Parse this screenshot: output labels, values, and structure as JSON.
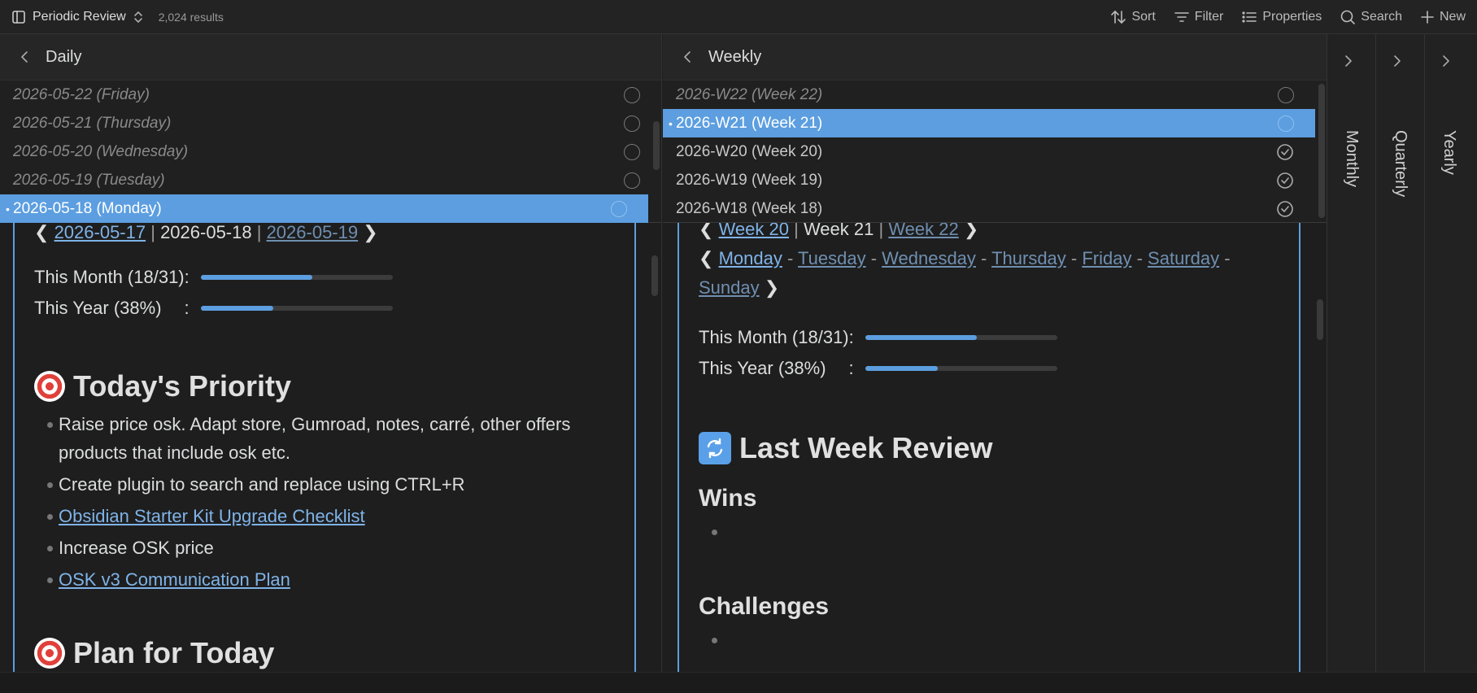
{
  "topbar": {
    "title": "Periodic Review",
    "count": "2,024 results",
    "sort": "Sort",
    "filter": "Filter",
    "properties": "Properties",
    "search": "Search",
    "new": "New"
  },
  "daily": {
    "title": "Daily",
    "rows": [
      {
        "label": "2026-05-22 (Friday)"
      },
      {
        "label": "2026-05-21 (Thursday)"
      },
      {
        "label": "2026-05-20 (Wednesday)"
      },
      {
        "label": "2026-05-19 (Tuesday)"
      },
      {
        "label": "2026-05-18 (Monday)"
      }
    ],
    "note": {
      "prev_arrow": "❮",
      "prev": "2026-05-17",
      "sep1": " | ",
      "current": "2026-05-18",
      "sep2": " | ",
      "next": "2026-05-19",
      "next_arrow": "❯",
      "month_label": "This Month (18/31):",
      "month_progress": 0.58,
      "year_label": "This Year (38%)",
      "year_colon": ":",
      "year_progress": 0.38,
      "priority_title": "Today's Priority",
      "priorities": [
        {
          "text": "Raise price osk. Adapt store, Gumroad, notes, carré, other offers products that include osk etc."
        },
        {
          "text": "Create plugin to search and replace using CTRL+R"
        },
        {
          "text": "Obsidian Starter Kit Upgrade Checklist"
        },
        {
          "text": "Increase OSK price"
        },
        {
          "text": "OSK v3 Communication Plan"
        }
      ],
      "plan_title": "Plan for Today"
    }
  },
  "weekly": {
    "title": "Weekly",
    "rows": [
      {
        "label": "2026-W22 (Week 22)"
      },
      {
        "label": "2026-W21 (Week 21)"
      },
      {
        "label": "2026-W20 (Week 20)"
      },
      {
        "label": "2026-W19 (Week 19)"
      },
      {
        "label": "2026-W18 (Week 18)"
      }
    ],
    "note": {
      "prev_arrow": "❮",
      "prev": "Week 20",
      "sep1": " | ",
      "current": "Week 21",
      "sep2": " | ",
      "next": "Week 22",
      "next_arrow": "❯",
      "days": [
        "Monday",
        "Tuesday",
        "Wednesday",
        "Thursday",
        "Friday",
        "Saturday",
        "Sunday"
      ],
      "dash": " - ",
      "month_label": "This Month (18/31):",
      "month_progress": 0.58,
      "year_label": "This Year (38%)",
      "year_colon": ":",
      "year_progress": 0.38,
      "review_title": "Last Week Review",
      "wins": "Wins",
      "challenges": "Challenges"
    }
  },
  "sidebar": {
    "monthly": "Monthly",
    "quarterly": "Quarterly",
    "yearly": "Yearly"
  },
  "colors": {
    "accent": "#5c9ee0",
    "background": "#1e1e1e"
  }
}
